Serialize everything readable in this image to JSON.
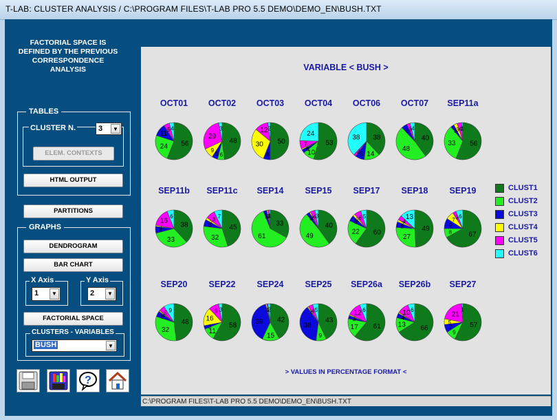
{
  "window": {
    "title": "T-LAB: CLUSTER ANALYSIS  /  C:\\PROGRAM FILES\\T-LAB PRO 5.5 DEMO\\DEMO_EN\\BUSH.TXT"
  },
  "left": {
    "intro": "FACTORIAL SPACE IS DEFINED BY THE PREVIOUS CORRESPONDENCE ANALYSIS",
    "tables_label": "TABLES",
    "cluster_n_label": "CLUSTER N.",
    "cluster_n_value": "3",
    "elem_contexts": "ELEM. CONTEXTS",
    "html_output": "HTML OUTPUT",
    "partitions": "PARTITIONS",
    "graphs_label": "GRAPHS",
    "dendrogram": "DENDROGRAM",
    "bar_chart": "BAR CHART",
    "x_axis_label": "X Axis",
    "x_axis_value": "1",
    "y_axis_label": "Y Axis",
    "y_axis_value": "2",
    "factorial_space": "FACTORIAL SPACE",
    "clusters_variables_label": "CLUSTERS - VARIABLES",
    "clusters_variables_value": "BUSH",
    "icons": [
      "disk-icon",
      "multi-save-icon",
      "help-icon",
      "home-icon"
    ]
  },
  "panel": {
    "title": "VARIABLE < BUSH >",
    "footnote": "> VALUES IN PERCENTAGE FORMAT <",
    "status": "C:\\PROGRAM FILES\\T-LAB PRO 5.5 DEMO\\DEMO_EN\\BUSH.TXT"
  },
  "colors": {
    "CLUST1": "#0f7a1c",
    "CLUST2": "#22ee22",
    "CLUST3": "#0a0adc",
    "CLUST4": "#ffff00",
    "CLUST5": "#ff00ff",
    "CLUST6": "#22ffff"
  },
  "chart_data": {
    "type": "pie",
    "title": "VARIABLE < BUSH >",
    "note": "> VALUES IN PERCENTAGE FORMAT <",
    "legend": [
      "CLUST1",
      "CLUST2",
      "CLUST3",
      "CLUST4",
      "CLUST5",
      "CLUST6"
    ],
    "legend_placement": "right",
    "pies": [
      {
        "label": "OCT01",
        "values": [
          56,
          24,
          11,
          0,
          5,
          4
        ]
      },
      {
        "label": "OCT02",
        "values": [
          48,
          6,
          5,
          9,
          29,
          3
        ]
      },
      {
        "label": "OCT03",
        "values": [
          50,
          0,
          6,
          30,
          12,
          2
        ]
      },
      {
        "label": "OCT04",
        "values": [
          53,
          10,
          3,
          1,
          7,
          24
        ]
      },
      {
        "label": "OCT06",
        "values": [
          38,
          14,
          8,
          0,
          2,
          38
        ]
      },
      {
        "label": "OCT07",
        "values": [
          40,
          48,
          5,
          0,
          3,
          4
        ]
      },
      {
        "label": "SEP11a",
        "values": [
          56,
          33,
          3,
          3,
          4,
          1
        ]
      },
      {
        "label": "SEP11b",
        "values": [
          38,
          33,
          6,
          1,
          16,
          6
        ]
      },
      {
        "label": "SEP11c",
        "values": [
          45,
          32,
          6,
          2,
          8,
          7
        ]
      },
      {
        "label": "SEP14",
        "values": [
          33,
          61,
          3,
          1,
          1,
          1
        ]
      },
      {
        "label": "SEP15",
        "values": [
          40,
          49,
          3,
          1,
          4,
          3
        ]
      },
      {
        "label": "SEP17",
        "values": [
          60,
          22,
          5,
          2,
          6,
          5
        ]
      },
      {
        "label": "SEP18",
        "values": [
          49,
          27,
          5,
          2,
          4,
          13
        ]
      },
      {
        "label": "SEP19",
        "values": [
          67,
          8,
          9,
          7,
          3,
          6
        ]
      },
      {
        "label": "SEP20",
        "values": [
          48,
          32,
          5,
          1,
          5,
          9
        ]
      },
      {
        "label": "SEP22",
        "values": [
          58,
          11,
          3,
          16,
          9,
          3
        ]
      },
      {
        "label": "SEP24",
        "values": [
          42,
          15,
          39,
          1,
          1,
          2
        ]
      },
      {
        "label": "SEP25",
        "values": [
          43,
          9,
          38,
          1,
          4,
          5
        ]
      },
      {
        "label": "SEP26a",
        "values": [
          61,
          17,
          3,
          1,
          12,
          6
        ]
      },
      {
        "label": "SEP26b",
        "values": [
          66,
          13,
          4,
          1,
          10,
          6
        ]
      },
      {
        "label": "SEP27",
        "values": [
          57,
          9,
          7,
          5,
          21,
          1
        ]
      }
    ]
  }
}
